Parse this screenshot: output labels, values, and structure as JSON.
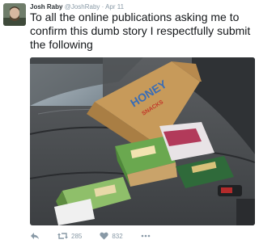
{
  "tweet": {
    "author_name": "Josh Raby",
    "author_handle": "@JoshRaby",
    "separator": "·",
    "timestamp": "Apr 11",
    "text": "To all the online publications asking me to confirm this dumb story I respectfully submit the following",
    "retweet_count": "285",
    "like_count": "832"
  },
  "photo": {
    "bag_text": "HONEY",
    "bag_subtext": "SNACKS"
  },
  "icons": [
    "reply-icon",
    "retweet-icon",
    "like-icon",
    "more-icon"
  ],
  "colors": {
    "meta": "#8899a6",
    "text": "#14171a",
    "name": "#292f33"
  }
}
